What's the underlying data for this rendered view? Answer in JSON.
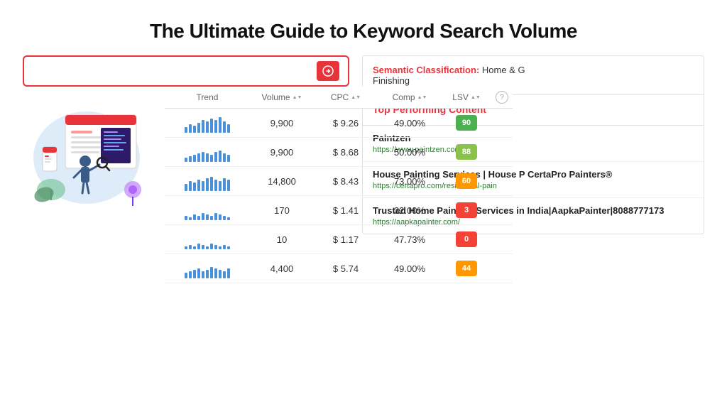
{
  "header": {
    "title": "The Ultimate Guide to Keyword Search Volume"
  },
  "search_bar": {
    "placeholder": "",
    "icon": "→"
  },
  "table": {
    "columns": [
      "Trend",
      "Volume",
      "CPC",
      "Comp",
      "LSV",
      "help"
    ],
    "rows": [
      {
        "trend_heights": [
          8,
          12,
          10,
          14,
          18,
          16,
          20,
          18,
          22,
          16,
          12
        ],
        "volume": "9,900",
        "cpc": "$ 9.26",
        "comp": "49.00%",
        "lsv": "90",
        "lsv_color": "green"
      },
      {
        "trend_heights": [
          6,
          8,
          10,
          12,
          14,
          12,
          10,
          14,
          16,
          12,
          10
        ],
        "volume": "9,900",
        "cpc": "$ 8.68",
        "comp": "50.00%",
        "lsv": "88",
        "lsv_color": "light-green"
      },
      {
        "trend_heights": [
          10,
          14,
          12,
          16,
          14,
          18,
          20,
          16,
          14,
          18,
          16
        ],
        "volume": "14,800",
        "cpc": "$ 8.43",
        "comp": "73.00%",
        "lsv": "60",
        "lsv_color": "orange"
      },
      {
        "trend_heights": [
          6,
          4,
          8,
          6,
          10,
          8,
          6,
          10,
          8,
          6,
          4
        ],
        "volume": "170",
        "cpc": "$ 1.41",
        "comp": "32.00%",
        "lsv": "3",
        "lsv_color": "red"
      },
      {
        "trend_heights": [
          4,
          6,
          4,
          8,
          6,
          4,
          8,
          6,
          4,
          6,
          4
        ],
        "volume": "10",
        "cpc": "$ 1.17",
        "comp": "47.73%",
        "lsv": "0",
        "lsv_color": "red"
      },
      {
        "trend_heights": [
          8,
          10,
          12,
          14,
          10,
          12,
          16,
          14,
          12,
          10,
          14
        ],
        "volume": "4,400",
        "cpc": "$ 5.74",
        "comp": "49.00%",
        "lsv": "44",
        "lsv_color": "orange"
      }
    ]
  },
  "right_panel": {
    "semantic": {
      "key": "Semantic Classification:",
      "value": "Home & G Finishing"
    },
    "top_performing": {
      "title": "Top Performing Content"
    },
    "items": [
      {
        "title": "Paintzen",
        "url": "https://www.paintzen.com/"
      },
      {
        "title": "House Painting Services | House P CertaPro Painters®",
        "url": "https://certapro.com/residential-pain"
      },
      {
        "title": "Trusted Home Painting Services in India|AapkaPainter|8088777173",
        "url": "https://aapkapainter.com/"
      }
    ]
  }
}
